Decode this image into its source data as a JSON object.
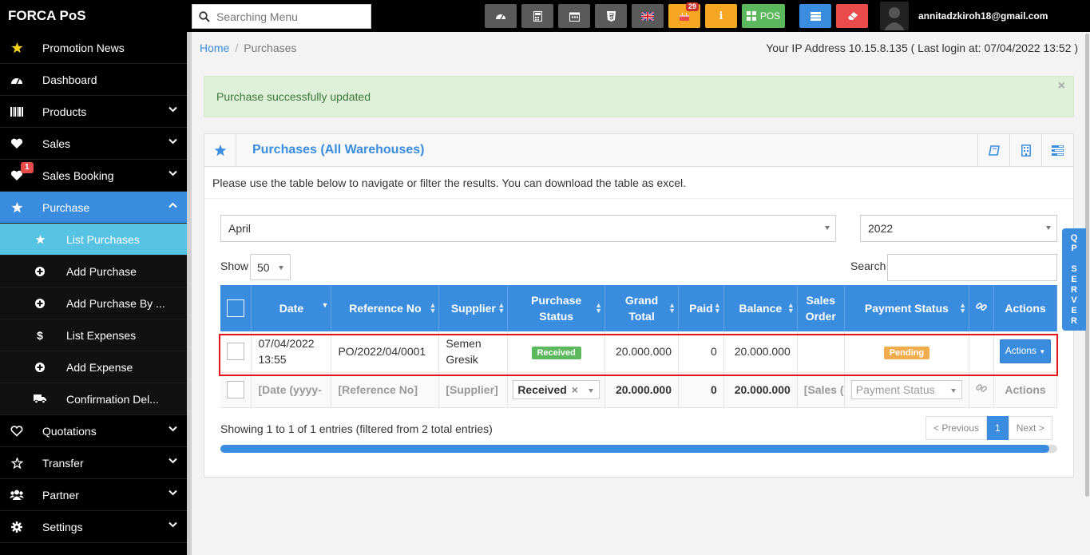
{
  "app": {
    "brand": "FORCA PoS"
  },
  "topbar": {
    "search_placeholder": "Searching Menu",
    "notification_count": "29",
    "pos_label": "POS",
    "user_email": "annitadzkiroh18@gmail.com"
  },
  "sidebar": {
    "items": [
      {
        "label": "Promotion News",
        "icon": "star-icon"
      },
      {
        "label": "Dashboard",
        "icon": "dashboard-icon"
      },
      {
        "label": "Products",
        "icon": "barcode-icon"
      },
      {
        "label": "Sales",
        "icon": "heart-icon"
      },
      {
        "label": "Sales Booking",
        "icon": "heart-icon",
        "badge": "1"
      },
      {
        "label": "Purchase",
        "icon": "star-icon"
      },
      {
        "label": "Quotations",
        "icon": "heart-outline-icon"
      },
      {
        "label": "Transfer",
        "icon": "star-outline-icon"
      },
      {
        "label": "Partner",
        "icon": "users-icon"
      },
      {
        "label": "Settings",
        "icon": "gear-icon"
      }
    ],
    "purchase_sub": [
      {
        "label": "List Purchases"
      },
      {
        "label": "Add Purchase"
      },
      {
        "label": "Add Purchase By ..."
      },
      {
        "label": "List Expenses"
      },
      {
        "label": "Add Expense"
      },
      {
        "label": "Confirmation Del..."
      }
    ]
  },
  "breadcrumb": {
    "home": "Home",
    "current": "Purchases"
  },
  "ip_info": "Your IP Address 10.15.8.135 ( Last login at: 07/04/2022 13:52 )",
  "alert": {
    "message": "Purchase successfully updated",
    "close": "×"
  },
  "box": {
    "title": "Purchases (All Warehouses)",
    "intro": "Please use the table below to navigate or filter the results. You can download the table as excel."
  },
  "filters": {
    "month": "April",
    "year": "2022"
  },
  "table_controls": {
    "show_label": "Show",
    "show_value": "50",
    "search_label": "Search"
  },
  "table": {
    "headers": [
      "Date",
      "Reference No",
      "Supplier",
      "Purchase Status",
      "Grand Total",
      "Paid",
      "Balance",
      "Sales Order",
      "Payment Status",
      "Actions"
    ],
    "headers_split": {
      "purchase_status": [
        "Purchase",
        "Status"
      ],
      "grand_total": [
        "Grand",
        "Total"
      ],
      "sales_order": [
        "Sales",
        "Order"
      ]
    },
    "rows": [
      {
        "date_line1": "07/04/2022",
        "date_line2": "13:55",
        "reference": "PO/2022/04/0001",
        "supplier_line1": "Semen",
        "supplier_line2": "Gresik",
        "purchase_status": "Received",
        "grand_total": "20.000.000",
        "paid": "0",
        "balance": "20.000.000",
        "sales_order": "",
        "payment_status": "Pending",
        "actions": "Actions"
      }
    ],
    "footer": {
      "date": "[Date (yyyy-",
      "reference": "[Reference No]",
      "supplier": "[Supplier]",
      "purchase_status": "Received",
      "grand_total": "20.000.000",
      "paid": "0",
      "balance": "20.000.000",
      "sales_order": "[Sales (",
      "payment_status": "Payment Status",
      "actions": "Actions"
    }
  },
  "pagination": {
    "info": "Showing 1 to 1 of 1 entries (filtered from 2 total entries)",
    "previous": "< Previous",
    "current": "1",
    "next": "Next >"
  },
  "progress": {
    "value": 0.99
  },
  "side_tab": {
    "letters": [
      "Q",
      "P",
      "",
      "S",
      "E",
      "R",
      "V",
      "E",
      "R"
    ]
  },
  "colors": {
    "accent": "#3a8dde",
    "success": "#5cb85c",
    "warning": "#f0ad4e",
    "highlight": "#e0161b"
  }
}
